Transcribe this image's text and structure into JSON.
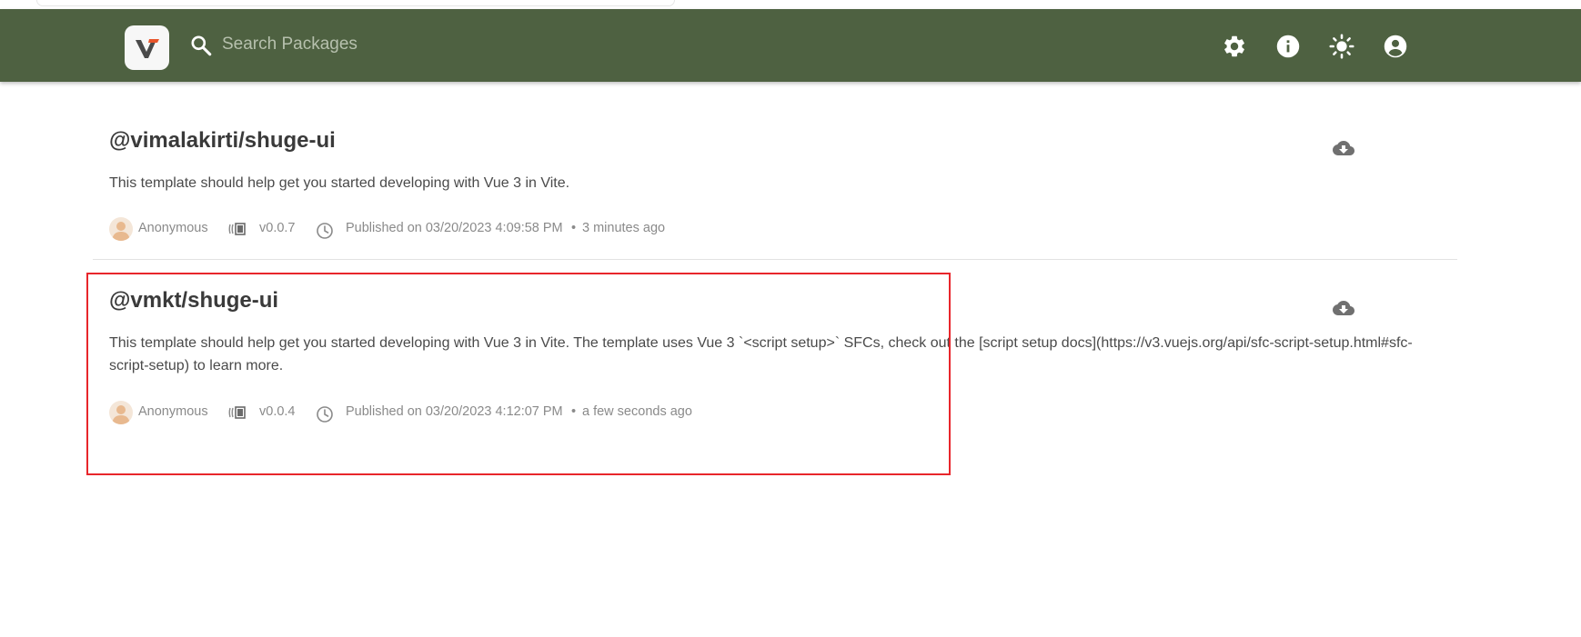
{
  "search": {
    "placeholder": "Search Packages"
  },
  "header": {
    "icons": [
      "settings-icon",
      "info-icon",
      "theme-toggle-icon",
      "account-icon"
    ],
    "background": "#4e6141"
  },
  "packages": [
    {
      "name": "@vimalakirti/shuge-ui",
      "description": "This template should help get you started developing with Vue 3 in Vite.",
      "author": "Anonymous",
      "version": "v0.0.7",
      "published": "Published on 03/20/2023 4:09:58 PM",
      "separator": "•",
      "relative_time": "3 minutes ago"
    },
    {
      "name": "@vmkt/shuge-ui",
      "description": "This template should help get you started developing with Vue 3 in Vite. The template uses Vue 3 `<script setup>` SFCs, check out the [script setup docs](https://v3.vuejs.org/api/sfc-script-setup.html#sfc-script-setup) to learn more.",
      "author": "Anonymous",
      "version": "v0.0.4",
      "published": "Published on 03/20/2023 4:12:07 PM",
      "separator": "•",
      "relative_time": "a few seconds ago"
    }
  ],
  "highlight_color": "#e8262b"
}
